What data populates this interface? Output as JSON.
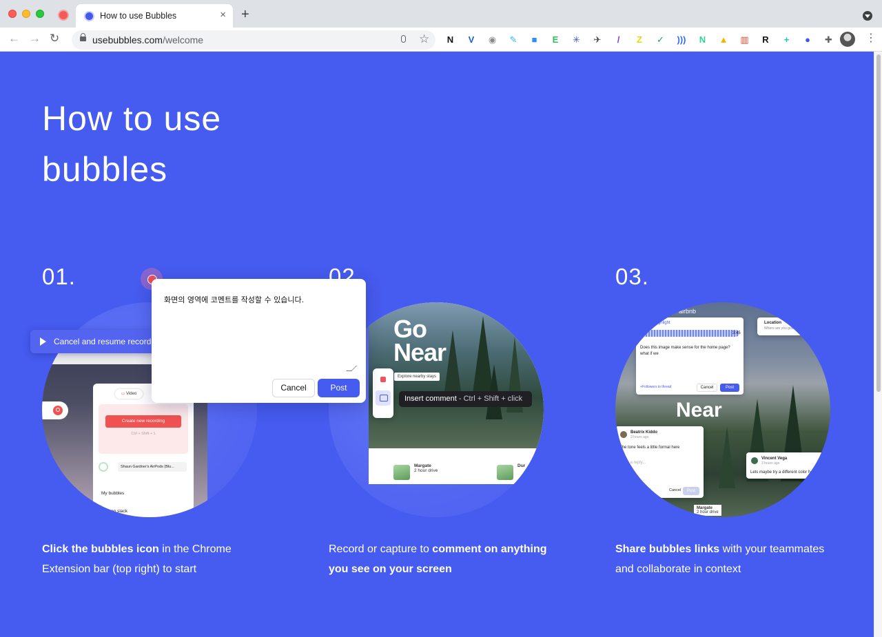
{
  "browser": {
    "tab_title": "How to use Bubbles",
    "tab_close": "×",
    "new_tab": "+",
    "url_domain": "usebubbles.com",
    "url_path": "/welcome",
    "nav_back": "←",
    "nav_forward": "→",
    "nav_reload": "↻",
    "star": "☆",
    "menu": "⋮",
    "extensions": [
      {
        "name": "notion-icon",
        "glyph": "N",
        "color": "#111111"
      },
      {
        "name": "vimeo-icon",
        "glyph": "V",
        "color": "#1a5fd6"
      },
      {
        "name": "camera-icon",
        "glyph": "◉",
        "color": "#8a8a8a"
      },
      {
        "name": "pen-icon",
        "glyph": "✎",
        "color": "#2fb5e0"
      },
      {
        "name": "zoom-icon",
        "glyph": "■",
        "color": "#2d8cff"
      },
      {
        "name": "evernote-icon",
        "glyph": "E",
        "color": "#2dbe60"
      },
      {
        "name": "asterisk-icon",
        "glyph": "✳",
        "color": "#4057d9"
      },
      {
        "name": "crane-icon",
        "glyph": "✈",
        "color": "#444444"
      },
      {
        "name": "feather-icon",
        "glyph": "/",
        "color": "#7b3fd9"
      },
      {
        "name": "z-icon",
        "glyph": "Z",
        "color": "#e9d700"
      },
      {
        "name": "check-icon",
        "glyph": "✓",
        "color": "#1aa34a"
      },
      {
        "name": "wave-icon",
        "glyph": ")))",
        "color": "#2f6bff"
      },
      {
        "name": "n-icon",
        "glyph": "N",
        "color": "#34d399"
      },
      {
        "name": "drive-icon",
        "glyph": "▲",
        "color": "#f4b400"
      },
      {
        "name": "chart-icon",
        "glyph": "▥",
        "color": "#e64a2e"
      },
      {
        "name": "r-icon",
        "glyph": "R",
        "color": "#111111"
      },
      {
        "name": "plus-circle-icon",
        "glyph": "+",
        "color": "#1cc6b4"
      },
      {
        "name": "bubbles-icon",
        "glyph": "●",
        "color": "#3f56ea"
      },
      {
        "name": "puzzle-icon",
        "glyph": "✚",
        "color": "#5f6368"
      }
    ]
  },
  "page": {
    "hero_title": "How to use bubbles",
    "steps": [
      {
        "number": "01.",
        "desc_bold": "Click the bubbles icon",
        "desc_rest": " in the Chrome Extension bar (top right) to start"
      },
      {
        "number": "02.",
        "desc_pre": "Record or capture to ",
        "desc_bold": "comment on anything you see on your screen"
      },
      {
        "number": "03.",
        "desc_bold": "Share bubbles links",
        "desc_rest": " with your teammates and collaborate in context"
      }
    ]
  },
  "step1_mock": {
    "video_tab": "Video",
    "create_button": "Create new recording",
    "shortcut": "Ctrl + Shift + 1",
    "mic_device": "Shaun Gardner's AirPods (Blu...",
    "my_bubbles": "My bubbles",
    "help": "help on slack",
    "resume_label": "Cancel and resume recording"
  },
  "modal": {
    "text": "화면의 영역에 코멘트를 작성할 수 있습니다.",
    "cancel": "Cancel",
    "post": "Post"
  },
  "step2_mock": {
    "headline_1": "Go",
    "headline_2": "Near",
    "explore": "Explore nearby stays",
    "listing_1_name": "Margate",
    "listing_1_sub": "2 hour drive",
    "listing_2_name": "Dur",
    "tooltip_label": "Insert comment",
    "tooltip_shortcut": " - Ctrl + Shift + click"
  },
  "step3_mock": {
    "brand": "airbnb",
    "headline": "Near",
    "view_highlight": "✓ View highlight",
    "duration": "3:45",
    "question": "Does this image make sense for the home page? what if we",
    "followers": "+Followers to thread",
    "cancel": "Cancel",
    "post": "Post",
    "location": "Location",
    "location_sub": "Where are you going?",
    "commenter_1": "Beatrix Kiddo",
    "commenter_1_time": "3 hours ago",
    "comment_1": "The tone feels a little formal here",
    "reply_placeholder": "Write a reply...",
    "commenter_2": "Vincent Vega",
    "commenter_2_time": "3 hours ago",
    "comment_2": "Lets maybe try a different color here",
    "listing_name": "Margate",
    "listing_sub": "2 hour drive"
  }
}
